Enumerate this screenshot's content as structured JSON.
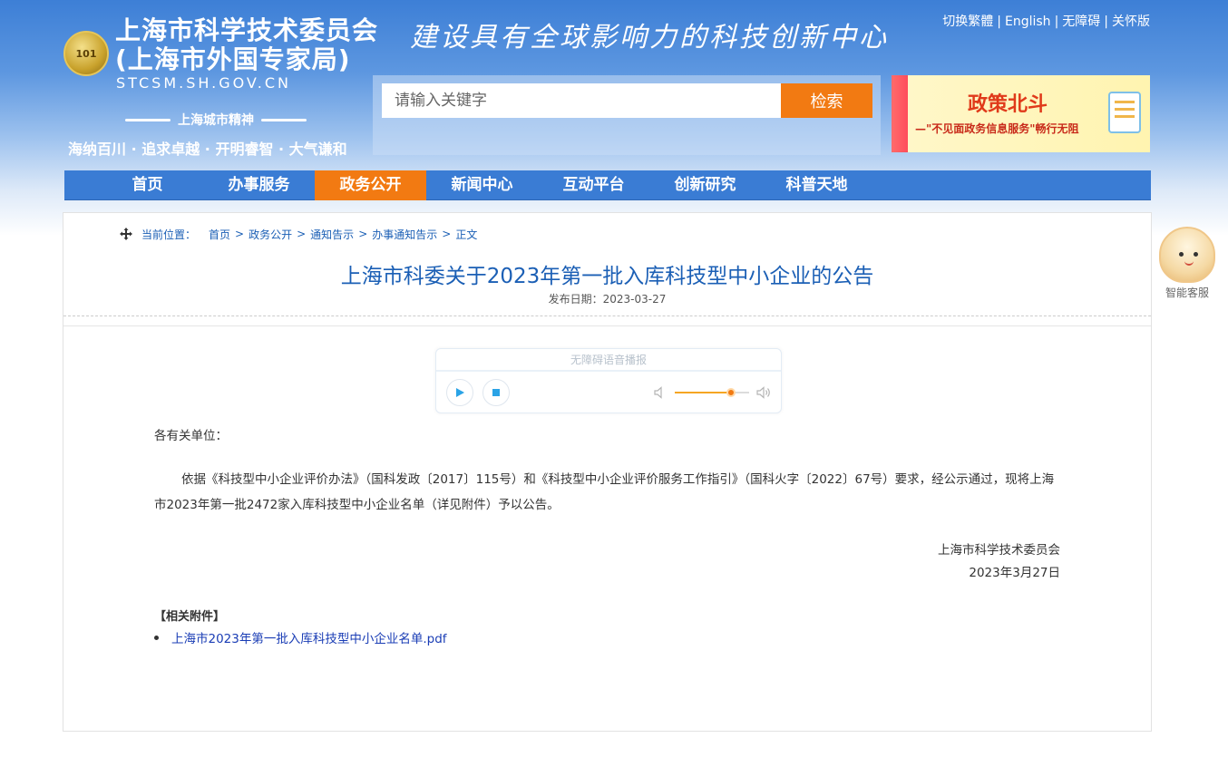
{
  "header": {
    "emblem_text": "101",
    "title_line1": "上海市科学技术委员会",
    "title_line2": "(上海市外国专家局)",
    "domain": "STCSM.SH.GOV.CN",
    "spirit_label": "上海城市精神",
    "spirit_text": "海纳百川 · 追求卓越 · 开明睿智 · 大气谦和",
    "slogan": "建设具有全球影响力的科技创新中心",
    "top_links": [
      "切换繁體",
      "English",
      "无障碍",
      "关怀版"
    ]
  },
  "search": {
    "placeholder": "请输入关键字",
    "button_label": "检索"
  },
  "banner": {
    "title": "政策北斗",
    "subtitle": "—\"不见面政务信息服务\"畅行无阻"
  },
  "nav": {
    "items": [
      "首页",
      "办事服务",
      "政务公开",
      "新闻中心",
      "互动平台",
      "创新研究",
      "科普天地"
    ],
    "active_index": 2
  },
  "breadcrumb": {
    "label": "当前位置：",
    "items": [
      "首页",
      "政务公开",
      "通知告示",
      "办事通知告示",
      "正文"
    ]
  },
  "article": {
    "title": "上海市科委关于2023年第一批入库科技型中小企业的公告",
    "publish_date": "发布日期：2023-03-27",
    "greeting": "各有关单位：",
    "body": "依据《科技型中小企业评价办法》（国科发政〔2017〕115号）和《科技型中小企业评价服务工作指引》（国科火字〔2022〕67号）要求，经公示通过，现将上海市2023年第一批2472家入库科技型中小企业名单（详见附件）予以公告。",
    "sign_org": "上海市科学技术委员会",
    "sign_date": "2023年3月27日"
  },
  "audio": {
    "title": "无障碍语音播报",
    "volume": 0.75
  },
  "attachments": {
    "heading": "【相关附件】",
    "files": [
      "上海市2023年第一批入库科技型中小企业名单.pdf"
    ]
  },
  "float_service": {
    "label": "智能客服"
  },
  "colors": {
    "nav_bg": "#3a7cd4",
    "accent_orange": "#f27a12",
    "link_blue": "#1b5fb5"
  }
}
